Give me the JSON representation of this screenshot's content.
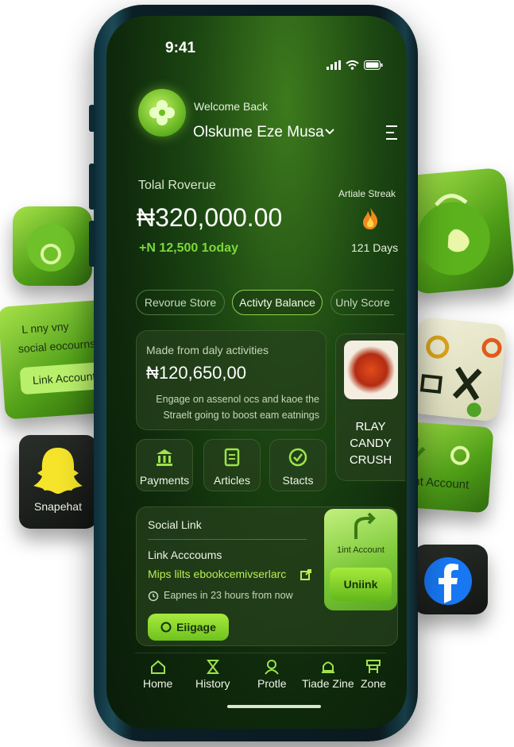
{
  "status": {
    "time": "9:41"
  },
  "profile": {
    "greeting": "Welcome Back",
    "name": "Olskume Eze Musa"
  },
  "revenue": {
    "label": "Tolal Roverue",
    "value": "₦320,000.00",
    "change": "+N 12,500 1oday"
  },
  "streak": {
    "label": "Artiale Streak",
    "days": "121 Days"
  },
  "pills": [
    {
      "label": "Revorue Store",
      "active": false
    },
    {
      "label": "Activty Balance",
      "active": true
    },
    {
      "label": "Unly Score",
      "active": false
    }
  ],
  "daily_card": {
    "label": "Made from daly activities",
    "value": "₦120,650,00",
    "description": "Engage on assenol ocs and kaoe the Straelt going to boost eam eatnings"
  },
  "game_card": {
    "title_line1": "RLAY",
    "title_line2": "CANDY",
    "title_line3": "CRUSH"
  },
  "quick_actions": [
    {
      "label": "Payments",
      "icon": "bank-icon"
    },
    {
      "label": "Articles",
      "icon": "document-icon"
    },
    {
      "label": "Stacts",
      "icon": "check-circle-icon"
    }
  ],
  "social": {
    "title": "Social Link",
    "link_label": "Link Acccoums",
    "url": "Mips lilts ebookcemivserlarc",
    "expiry": "Eapnes in 23 hours from now",
    "engage_label": "Eiigage",
    "link_card_label": "1int Account",
    "unlink_label": "Uniink"
  },
  "tabs": [
    {
      "label": "Home",
      "icon": "home-icon"
    },
    {
      "label": "History",
      "icon": "hourglass-icon"
    },
    {
      "label": "Protle",
      "icon": "profile-icon"
    },
    {
      "label": "Tiade Zine",
      "icon": "bell-icon"
    },
    {
      "label": "Zone",
      "icon": "zone-icon"
    }
  ],
  "floating": {
    "left_card_text_line1": "L nny vny",
    "left_card_text_line2": "social eocourns",
    "left_card_button": "Link Account",
    "snapchat_label": "Snapehat",
    "right_link_label": "Lint Account"
  },
  "colors": {
    "accent": "#8fd04a",
    "accent_bright": "#b7ee4e",
    "dark_bg": "#0f2a0c"
  }
}
